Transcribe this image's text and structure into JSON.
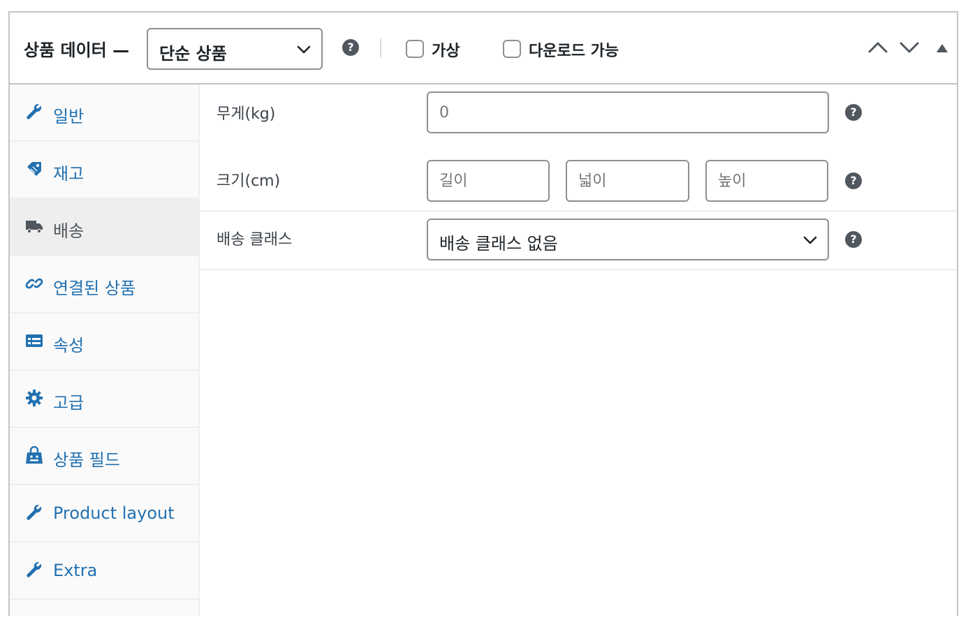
{
  "header": {
    "title": "상품 데이터 —",
    "product_type": "단순 상품",
    "help": "?",
    "virtual_label": "가상",
    "downloadable_label": "다운로드 가능"
  },
  "tabs": [
    {
      "label": "일반",
      "icon": "wrench-icon"
    },
    {
      "label": "재고",
      "icon": "tag-icon"
    },
    {
      "label": "배송",
      "icon": "truck-icon",
      "active": true
    },
    {
      "label": "연결된 상품",
      "icon": "link-icon"
    },
    {
      "label": "속성",
      "icon": "list-icon"
    },
    {
      "label": "고급",
      "icon": "gear-icon"
    },
    {
      "label": "상품 필드",
      "icon": "bag-icon"
    },
    {
      "label": "Product layout",
      "icon": "wrench-icon"
    },
    {
      "label": "Extra",
      "icon": "wrench-icon"
    }
  ],
  "shipping": {
    "weight_label": "무게(kg)",
    "weight_placeholder": "0",
    "dimensions_label": "크기(cm)",
    "length_placeholder": "길이",
    "width_placeholder": "넓이",
    "height_placeholder": "높이",
    "class_label": "배송 클래스",
    "class_value": "배송 클래스 없음",
    "help": "?"
  },
  "colors": {
    "link": "#2271b1",
    "border": "#8c8f94",
    "active_tab_bg": "#eeeeee"
  }
}
